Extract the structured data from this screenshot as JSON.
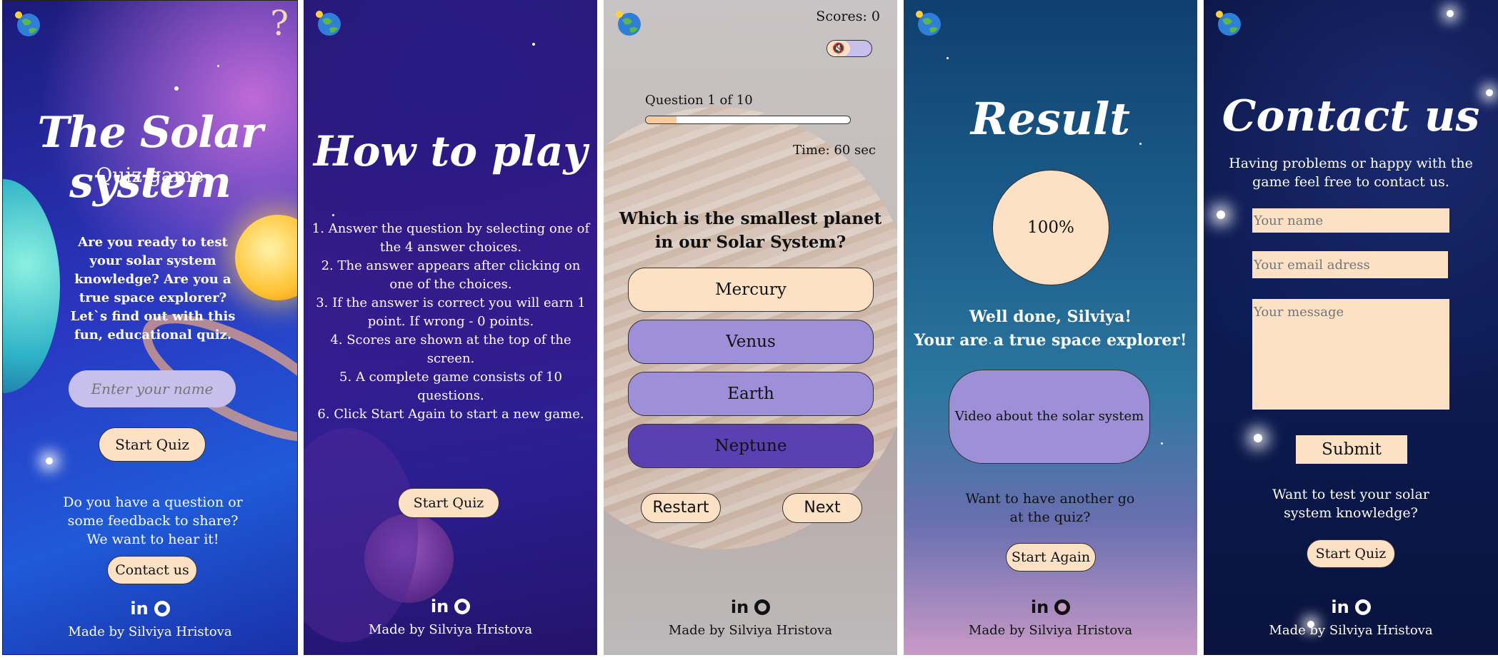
{
  "screen1": {
    "title": "The Solar system",
    "subtitle": "Quiz game",
    "intro": "Are you ready to test your solar system knowledge? Are you a true space explorer? Let`s find out with this fun, educational quiz.",
    "name_placeholder": "Enter your name",
    "start_label": "Start Quiz",
    "question_text": "Do you have a question or some feedback to share? We want to hear it!",
    "contact_label": "Contact us",
    "help_icon": "?"
  },
  "screen2": {
    "title": "How to play",
    "rules": [
      "1. Answer the question by selecting one of the 4 answer choices.",
      "2. The answer appears after clicking on one of the choices.",
      "3. If the answer is correct you will earn 1 point. If wrong - 0 points.",
      "4. Scores are shown at the top of the screen.",
      "5. A complete game consists of 10 questions.",
      "6. Click Start Again to start a new game."
    ],
    "start_label": "Start Quiz"
  },
  "screen3": {
    "scores": "Scores: 0",
    "question_counter": "Question 1 of 10",
    "progress": 0.15,
    "timer": "Time: 60 sec",
    "question": "Which is the smallest planet in our Solar System?",
    "answers": [
      "Mercury",
      "Venus",
      "Earth",
      "Neptune"
    ],
    "restart_label": "Restart",
    "next_label": "Next"
  },
  "screen4": {
    "title": "Result",
    "score": "100%",
    "message_line1": "Well done, Silviya!",
    "message_line2": "Your are a true space explorer!",
    "video_label": "Video about the solar system",
    "again_text": "Want to have another go at the quiz?",
    "again_label": "Start Again"
  },
  "screen5": {
    "title": "Contact us",
    "intro": "Having problems or happy with the game feel free to contact us.",
    "name_placeholder": "Your name",
    "email_placeholder": "Your email adress",
    "message_placeholder": "Your message",
    "submit_label": "Submit",
    "test_text": "Want to test your solar system knowledge?",
    "start_label": "Start Quiz"
  },
  "footer": {
    "linkedin": "in",
    "credit": "Made by Silviya Hristova"
  },
  "icons": {
    "logo": "globe-icon",
    "help": "question-mark-icon",
    "sound": "mute-icon",
    "linkedin": "linkedin-icon",
    "github": "github-icon"
  },
  "colors": {
    "accent_peach": "#fde1c4",
    "answer_purple": "#9d8fd8",
    "answer_dark": "#5a40b0",
    "name_input": "#c8c0ec"
  }
}
